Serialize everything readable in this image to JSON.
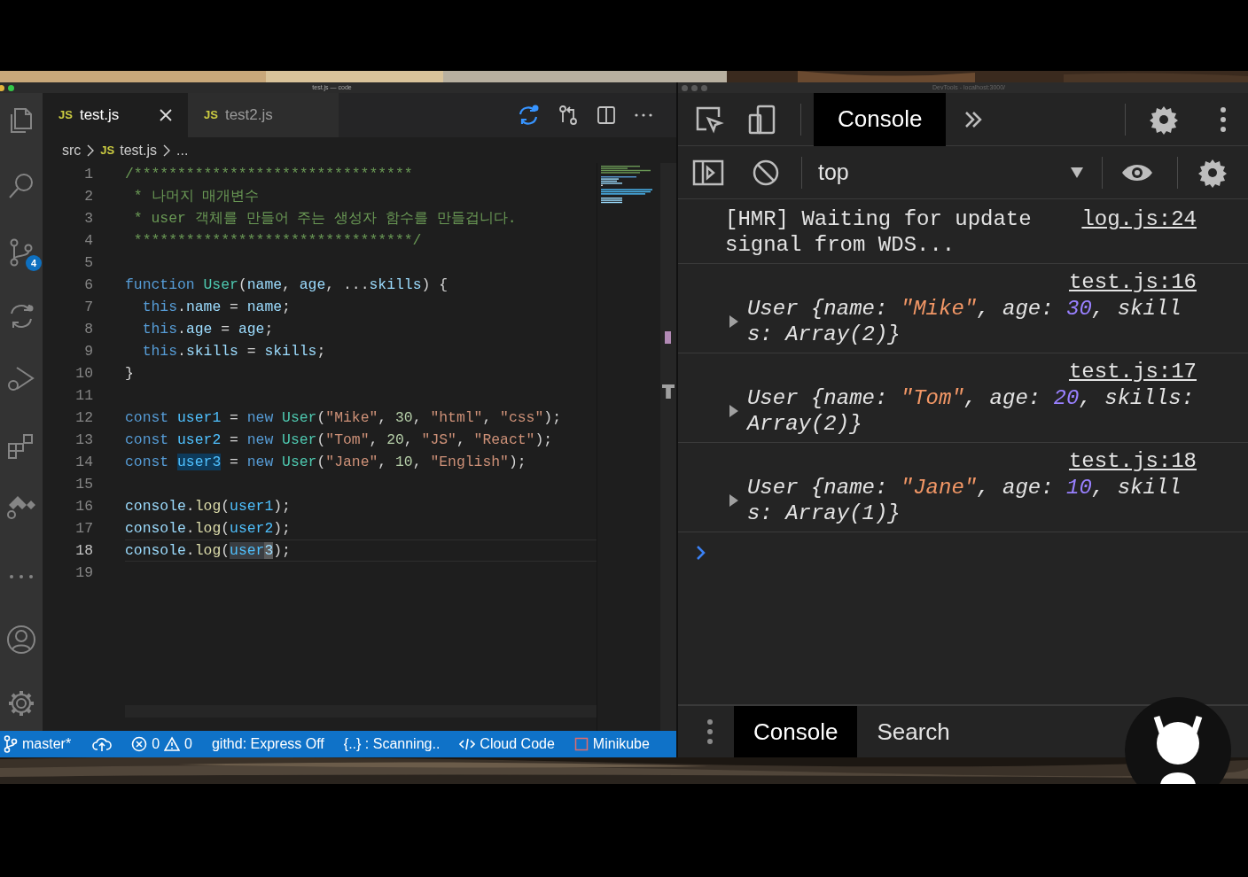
{
  "editor_window": {
    "title": "test.js — code",
    "source_control_badge": "4",
    "tabs": [
      {
        "icon": "JS",
        "label": "test.js",
        "selected": true
      },
      {
        "icon": "JS",
        "label": "test2.js",
        "selected": false
      }
    ],
    "breadcrumb": [
      {
        "text": "src"
      },
      {
        "icon": "JS",
        "text": "test.js"
      },
      {
        "text": "..."
      }
    ],
    "lines": [
      {
        "number": "1",
        "current": false,
        "tokens": [
          {
            "kind": "comment",
            "text": "/********************************"
          }
        ]
      },
      {
        "number": "2",
        "current": false,
        "tokens": [
          {
            "kind": "comment",
            "text": " * 나머지 매개변수"
          }
        ]
      },
      {
        "number": "3",
        "current": false,
        "tokens": [
          {
            "kind": "comment",
            "text": " * user 객체를 만들어 주는 생성자 함수를 만들겁니다."
          }
        ]
      },
      {
        "number": "4",
        "current": false,
        "tokens": [
          {
            "kind": "comment",
            "text": " ********************************/"
          }
        ]
      },
      {
        "number": "5",
        "current": false
      },
      {
        "number": "6",
        "current": false,
        "tokens": [
          {
            "kind": "keyword",
            "text": "function "
          },
          {
            "kind": "class",
            "text": "User"
          },
          {
            "kind": "plain",
            "text": "("
          },
          {
            "kind": "variable",
            "text": "name"
          },
          {
            "kind": "plain",
            "text": ", "
          },
          {
            "kind": "variable",
            "text": "age"
          },
          {
            "kind": "plain",
            "text": ", ..."
          },
          {
            "kind": "variable",
            "text": "skills"
          },
          {
            "kind": "plain",
            "text": ") {"
          }
        ]
      },
      {
        "number": "7",
        "current": false,
        "tokens": [
          {
            "kind": "keyword",
            "text": "  this"
          },
          {
            "kind": "plain",
            "text": "."
          },
          {
            "kind": "variable",
            "text": "name"
          },
          {
            "kind": "plain",
            "text": " = "
          },
          {
            "kind": "variable",
            "text": "name"
          },
          {
            "kind": "plain",
            "text": ";"
          }
        ]
      },
      {
        "number": "8",
        "current": false,
        "tokens": [
          {
            "kind": "keyword",
            "text": "  this"
          },
          {
            "kind": "plain",
            "text": "."
          },
          {
            "kind": "variable",
            "text": "age"
          },
          {
            "kind": "plain",
            "text": " = "
          },
          {
            "kind": "variable",
            "text": "age"
          },
          {
            "kind": "plain",
            "text": ";"
          }
        ]
      },
      {
        "number": "9",
        "current": false,
        "tokens": [
          {
            "kind": "keyword",
            "text": "  this"
          },
          {
            "kind": "plain",
            "text": "."
          },
          {
            "kind": "variable",
            "text": "skills"
          },
          {
            "kind": "plain",
            "text": " = "
          },
          {
            "kind": "variable",
            "text": "skills"
          },
          {
            "kind": "plain",
            "text": ";"
          }
        ]
      },
      {
        "number": "10",
        "current": false,
        "tokens": [
          {
            "kind": "plain",
            "text": "}"
          }
        ]
      },
      {
        "number": "11",
        "current": false
      },
      {
        "number": "12",
        "current": false,
        "tokens": [
          {
            "kind": "keyword",
            "text": "const "
          },
          {
            "kind": "const",
            "text": "user1"
          },
          {
            "kind": "plain",
            "text": " = "
          },
          {
            "kind": "keyword",
            "text": "new "
          },
          {
            "kind": "class",
            "text": "User"
          },
          {
            "kind": "plain",
            "text": "("
          },
          {
            "kind": "string",
            "text": "\"Mike\""
          },
          {
            "kind": "plain",
            "text": ", "
          },
          {
            "kind": "number",
            "text": "30"
          },
          {
            "kind": "plain",
            "text": ", "
          },
          {
            "kind": "string",
            "text": "\"html\""
          },
          {
            "kind": "plain",
            "text": ", "
          },
          {
            "kind": "string",
            "text": "\"css\""
          },
          {
            "kind": "plain",
            "text": ");"
          }
        ]
      },
      {
        "number": "13",
        "current": false,
        "tokens": [
          {
            "kind": "keyword",
            "text": "const "
          },
          {
            "kind": "const",
            "text": "user2"
          },
          {
            "kind": "plain",
            "text": " = "
          },
          {
            "kind": "keyword",
            "text": "new "
          },
          {
            "kind": "class",
            "text": "User"
          },
          {
            "kind": "plain",
            "text": "("
          },
          {
            "kind": "string",
            "text": "\"Tom\""
          },
          {
            "kind": "plain",
            "text": ", "
          },
          {
            "kind": "number",
            "text": "20"
          },
          {
            "kind": "plain",
            "text": ", "
          },
          {
            "kind": "string",
            "text": "\"JS\""
          },
          {
            "kind": "plain",
            "text": ", "
          },
          {
            "kind": "string",
            "text": "\"React\""
          },
          {
            "kind": "plain",
            "text": ");"
          }
        ]
      },
      {
        "number": "14",
        "current": false,
        "tokens": [
          {
            "kind": "keyword",
            "text": "const "
          },
          {
            "kind": "highlight",
            "text": "user3"
          },
          {
            "kind": "plain",
            "text": " = "
          },
          {
            "kind": "keyword",
            "text": "new "
          },
          {
            "kind": "class",
            "text": "User"
          },
          {
            "kind": "plain",
            "text": "("
          },
          {
            "kind": "string",
            "text": "\"Jane\""
          },
          {
            "kind": "plain",
            "text": ", "
          },
          {
            "kind": "number",
            "text": "10"
          },
          {
            "kind": "plain",
            "text": ", "
          },
          {
            "kind": "string",
            "text": "\"English\""
          },
          {
            "kind": "plain",
            "text": ");"
          }
        ]
      },
      {
        "number": "15",
        "current": false
      },
      {
        "number": "16",
        "current": false,
        "tokens": [
          {
            "kind": "variable",
            "text": "console"
          },
          {
            "kind": "plain",
            "text": "."
          },
          {
            "kind": "function",
            "text": "log"
          },
          {
            "kind": "plain",
            "text": "("
          },
          {
            "kind": "const",
            "text": "user1"
          },
          {
            "kind": "plain",
            "text": ");"
          }
        ]
      },
      {
        "number": "17",
        "current": false,
        "tokens": [
          {
            "kind": "variable",
            "text": "console"
          },
          {
            "kind": "plain",
            "text": "."
          },
          {
            "kind": "function",
            "text": "log"
          },
          {
            "kind": "plain",
            "text": "("
          },
          {
            "kind": "const",
            "text": "user2"
          },
          {
            "kind": "plain",
            "text": ");"
          }
        ]
      },
      {
        "number": "18",
        "current": true,
        "tokens": [
          {
            "kind": "variable",
            "text": "console"
          },
          {
            "kind": "plain",
            "text": "."
          },
          {
            "kind": "function",
            "text": "log"
          },
          {
            "kind": "plain",
            "text": "("
          },
          {
            "kind": "selection",
            "text": "user"
          },
          {
            "kind": "cursor",
            "text": "3"
          },
          {
            "kind": "plain",
            "text": ");"
          }
        ]
      },
      {
        "number": "19",
        "current": false
      }
    ],
    "status_bar": [
      {
        "kind": "branch",
        "text": "master*"
      },
      {
        "kind": "sync"
      },
      {
        "kind": "problems",
        "errors": "0",
        "warnings": "0"
      },
      {
        "kind": "text",
        "text": "githd: Express Off"
      },
      {
        "kind": "text",
        "text": "{..} : Scanning.."
      },
      {
        "kind": "cloud-code",
        "text": "Cloud Code"
      },
      {
        "kind": "minikube",
        "text": "Minikube"
      }
    ]
  },
  "devtools_window": {
    "title": "DevTools - localhost:3000/",
    "tabs": [
      {
        "label": "Console",
        "selected": true
      }
    ],
    "context": "top",
    "messages": [
      {
        "kind": "text",
        "text": "[HMR] Waiting for update signal from WDS...",
        "source": "log.js:24"
      },
      {
        "kind": "object",
        "source": "test.js:16",
        "tokens": [
          {
            "kind": "plain",
            "text": "User {name: "
          },
          {
            "kind": "string",
            "text": "\"Mike\""
          },
          {
            "kind": "plain",
            "text": ", age: "
          },
          {
            "kind": "number",
            "text": "30"
          },
          {
            "kind": "plain",
            "text": ", skills: Array(2)}"
          }
        ]
      },
      {
        "kind": "object",
        "source": "test.js:17",
        "tokens": [
          {
            "kind": "plain",
            "text": "User {name: "
          },
          {
            "kind": "string",
            "text": "\"Tom\""
          },
          {
            "kind": "plain",
            "text": ", age: "
          },
          {
            "kind": "number",
            "text": "20"
          },
          {
            "kind": "plain",
            "text": ", skills: Array(2)}"
          }
        ]
      },
      {
        "kind": "object",
        "source": "test.js:18",
        "tokens": [
          {
            "kind": "plain",
            "text": "User {name: "
          },
          {
            "kind": "string",
            "text": "\"Jane\""
          },
          {
            "kind": "plain",
            "text": ", age: "
          },
          {
            "kind": "number",
            "text": "10"
          },
          {
            "kind": "plain",
            "text": ", skills: Array(1)}"
          }
        ]
      }
    ],
    "drawer_tabs": [
      {
        "label": "Console",
        "selected": true
      },
      {
        "label": "Search",
        "selected": false
      }
    ]
  }
}
